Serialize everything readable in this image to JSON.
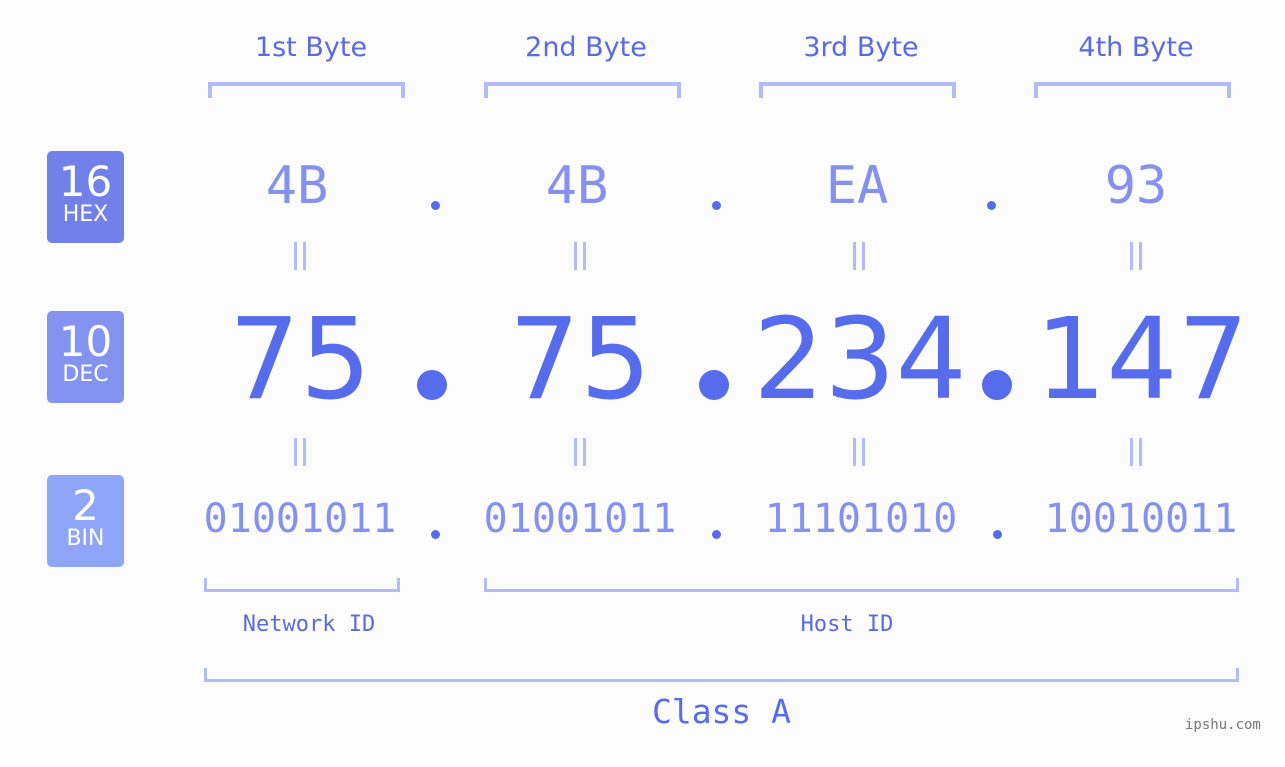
{
  "byte_headers": [
    "1st Byte",
    "2nd Byte",
    "3rd Byte",
    "4th Byte"
  ],
  "badges": [
    {
      "number": "16",
      "name": "HEX",
      "color": "#7280ea"
    },
    {
      "number": "10",
      "name": "DEC",
      "color": "#8593f0"
    },
    {
      "number": "2",
      "name": "BIN",
      "color": "#8fa5f7"
    }
  ],
  "hex": [
    "4B",
    "4B",
    "EA",
    "93"
  ],
  "dec": [
    "75",
    "75",
    "234",
    "147"
  ],
  "bin": [
    "01001011",
    "01001011",
    "11101010",
    "10010011"
  ],
  "separator": ".",
  "equals": "=",
  "segments": {
    "network": "Network ID",
    "host": "Host ID",
    "class": "Class A"
  },
  "watermark": "ipshu.com",
  "colors": {
    "accent": "#566cec",
    "light": "#8591ee",
    "bracket": "#b3bcf8"
  }
}
